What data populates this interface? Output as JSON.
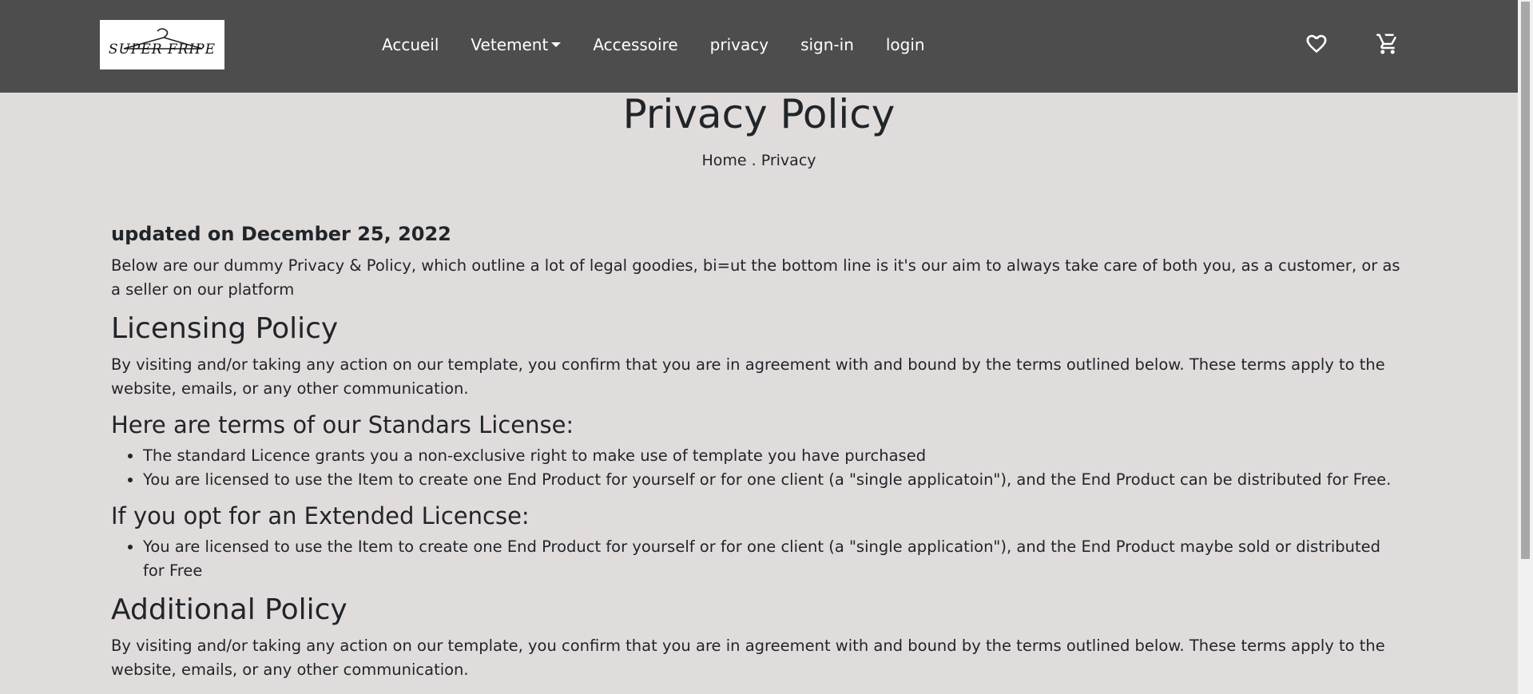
{
  "navbar": {
    "logo_text": "SUPER FRIPE",
    "links": [
      "Accueil",
      "Vetement",
      "Accessoire",
      "privacy",
      "sign-in",
      "login"
    ],
    "icons": [
      "heart-icon",
      "cart-icon"
    ],
    "background": "#4d4d4d"
  },
  "page": {
    "title": "Privacy Policy",
    "breadcrumb": "Home . Privacy",
    "background": "#e1dcdc"
  },
  "content": {
    "updated": "updated on December 25, 2022",
    "intro": "Below are our dummy Privacy & Policy, which outline a lot of legal goodies, bi=ut the bottom line is it's our aim to always take care of both you, as a customer, or as a seller on our platform",
    "licensing_heading": "Licensing Policy",
    "licensing_text": "By visiting and/or taking any action on our template, you confirm that you are in agreement with and bound by the terms outlined below. These terms apply to the website, emails, or any other communication.",
    "standard_heading": "Here are terms of our Standars License:",
    "standard_items": [
      "The standard Licence grants you a non-exclusive right to make use of template you have purchased",
      "You are licensed to use the Item to create one End Product for yourself or for one client (a \"single applicatoin\"), and the End Product can be distributed for Free."
    ],
    "extended_heading": "If you opt for an Extended Licencse:",
    "extended_items": [
      "You are licensed to use the Item to create one End Product for yourself or for one client (a \"single application\"), and the End Product maybe sold or distributed for Free"
    ],
    "additional_heading": "Additional Policy",
    "additional_text": "By visiting and/or taking any action on our template, you confirm that you are in agreement with and bound by the terms outlined below. These terms apply to the website, emails, or any other communication."
  }
}
